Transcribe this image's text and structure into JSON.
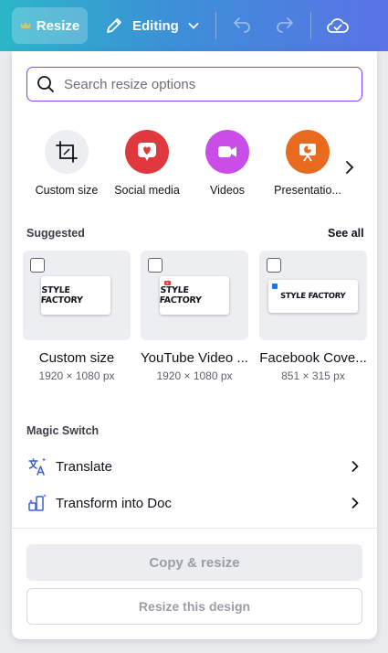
{
  "topbar": {
    "resize_label": "Resize",
    "editing_label": "Editing"
  },
  "search": {
    "placeholder": "Search resize options"
  },
  "categories": [
    {
      "label": "Custom size",
      "icon": "crop-resize-icon",
      "color": "#eceef1"
    },
    {
      "label": "Social media",
      "icon": "heart-chat-icon",
      "color": "#e0383e"
    },
    {
      "label": "Videos",
      "icon": "video-camera-icon",
      "color": "#c94de6"
    },
    {
      "label": "Presentatio...",
      "icon": "presentation-chart-icon",
      "color": "#e86a1e"
    }
  ],
  "suggested": {
    "title": "Suggested",
    "see_all": "See all",
    "items": [
      {
        "name": "Custom size",
        "dims": "1920 × 1080 px",
        "art_text": "STYLE FACTORY"
      },
      {
        "name": "YouTube Video ...",
        "dims": "1920 × 1080 px",
        "art_text": "STYLE FACTORY"
      },
      {
        "name": "Facebook Cove...",
        "dims": "851 × 315 px",
        "art_text": "STYLE FACTORY"
      }
    ]
  },
  "magic_switch": {
    "title": "Magic Switch",
    "items": [
      {
        "label": "Translate",
        "icon": "translate-icon"
      },
      {
        "label": "Transform into Doc",
        "icon": "magic-doc-icon"
      }
    ]
  },
  "actions": {
    "copy_resize": "Copy & resize",
    "resize_this": "Resize this design"
  },
  "colors": {
    "accent": "#8b3dff",
    "topbar_start": "#2bb6c8",
    "topbar_end": "#5a73e6"
  }
}
